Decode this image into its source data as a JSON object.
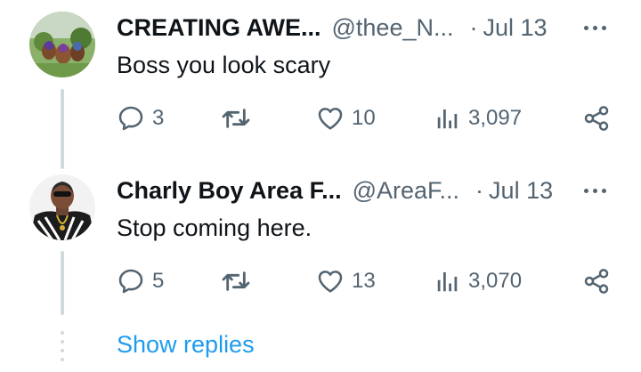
{
  "tweets": [
    {
      "name": "CREATING AWE...",
      "handle": "@thee_N...",
      "separator": "·",
      "date": "Jul 13",
      "text": "Boss you look scary",
      "replies": "3",
      "retweets": "",
      "likes": "10",
      "views": "3,097"
    },
    {
      "name": "Charly Boy Area F...",
      "handle": "@AreaF...",
      "separator": "·",
      "date": "Jul 13",
      "text": "Stop coming here.",
      "replies": "5",
      "retweets": "",
      "likes": "13",
      "views": "3,070"
    }
  ],
  "show_replies": "Show replies",
  "colors": {
    "text": "#0f1419",
    "muted": "#536471",
    "link": "#1d9bf0",
    "thread_line": "#cfd9de"
  },
  "icons": [
    "reply-icon",
    "retweet-icon",
    "like-icon",
    "views-icon",
    "share-icon",
    "more-icon"
  ]
}
